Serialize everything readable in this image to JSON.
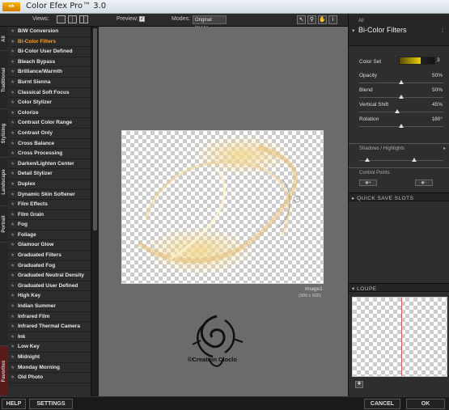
{
  "window": {
    "title": "Color Efex Pro™ 3.0",
    "logo_text": "nik"
  },
  "toolbar": {
    "views_label": "Views:",
    "preview_label": "Preview:",
    "preview_checked": "✓",
    "modes_label": "Modes:",
    "modes_value": "Original Image",
    "tools": [
      "arrow-icon",
      "zoom-icon",
      "hand-icon",
      "info-icon"
    ]
  },
  "tabs": [
    "All",
    "Traditional",
    "Stylizing",
    "Landscape",
    "Portrait",
    "Favorites"
  ],
  "filters": [
    "B/W Conversion",
    "Bi-Color Filters",
    "Bi-Color User Defined",
    "Bleach Bypass",
    "Brilliance/Warmth",
    "Burnt Sienna",
    "Classical Soft Focus",
    "Color Stylizer",
    "Colorize",
    "Contrast Color Range",
    "Contrast Only",
    "Cross Balance",
    "Cross Processing",
    "Darken/Lighten Center",
    "Detail Stylizer",
    "Duplex",
    "Dynamic Skin Softener",
    "Film Effects",
    "Film Grain",
    "Fog",
    "Foliage",
    "Glamour Glow",
    "Graduated Filters",
    "Graduated Fog",
    "Graduated Neutral Density",
    "Graduated User Defined",
    "High Key",
    "Indian Summer",
    "Infrared Film",
    "Infrared Thermal Camera",
    "Ink",
    "Low Key",
    "Midnight",
    "Monday Morning",
    "Old Photo"
  ],
  "active_filter": "Bi-Color Filters",
  "canvas": {
    "image_name": "Image1",
    "image_size": "(900 x 600)",
    "watermark": "©Creation Cloclo"
  },
  "panel": {
    "category": "All",
    "title": "Bi-Color Filters",
    "color_set_label": "Color Set",
    "color_set_value": "3",
    "params": [
      {
        "label": "Opacity",
        "value": "50%",
        "level": 0.5
      },
      {
        "label": "Blend",
        "value": "50%",
        "level": 0.5
      },
      {
        "label": "Vertical Shift",
        "value": "45%",
        "level": 0.45
      },
      {
        "label": "Rotation",
        "value": "180°",
        "level": 0.5
      }
    ],
    "shadows_label": "Shadows / Highlights",
    "control_points_label": "Control Points",
    "quick_save_label": "QUICK SAVE SLOTS",
    "loupe_label": "LOUPE"
  },
  "bottom": {
    "help": "HELP",
    "settings": "SETTINGS",
    "cancel": "CANCEL",
    "ok": "OK"
  }
}
